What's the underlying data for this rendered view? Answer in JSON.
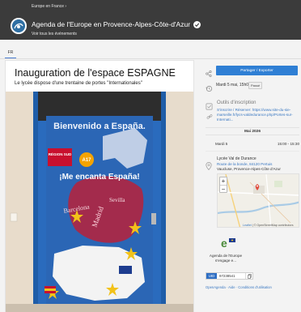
{
  "header": {
    "breadcrumb": "Europe en France ›",
    "title": "Agenda de l'Europe en Provence-Alpes-Côte-d'Azur",
    "all_events_link": "Voir tous les événements"
  },
  "tabs": [
    {
      "label": "FR",
      "active": true
    }
  ],
  "event": {
    "title": "Inauguration de l'espace ESPAGNE",
    "description": "Le lycée dispose d'une trentaine de portes \"Internationales\"",
    "photo": {
      "slogan_top": "Bienvenido a España.",
      "slogan_middle": "¡Me encanta España!",
      "region_logo_text": "RÉGION SUD",
      "motorway_sign": "A17",
      "words": [
        "Barcelona",
        "Madrid",
        "Sevilla"
      ]
    }
  },
  "sidebar": {
    "share_button": "Partager / Exporter",
    "date_label": "Mardi 5 mai, 15h00",
    "date_badge": "Passé",
    "registration": {
      "title": "Outils d'inscription",
      "text": "S'inscrire / Réserver: https://www.site-du-sie-marseille.fr/lycs-valdedurance.php/Portes-sur-Internati..."
    },
    "calendar": {
      "month": "Mai 2026",
      "day": "Mardi 5",
      "time": "15:00 - 15:30"
    },
    "venue": {
      "name": "Lycée Val de Durance",
      "address": "Route de la bonde, 84120 Pertuis",
      "region": "Vaucluse, Provence-Alpes-Côte d'Azur"
    },
    "map": {
      "zoom_in": "+",
      "zoom_out": "−",
      "attribution_link": "Leaflet",
      "attribution_text": " | © OpenStreetMap contributors"
    },
    "agenda": {
      "name": "Agenda de l'Europe s'engage e..."
    },
    "uid": {
      "label": "UID",
      "value": "97238541"
    },
    "footer": "OpenAgenda · Aide · Conditions d'utilisation"
  },
  "colors": {
    "header_bg": "#3b3b3b",
    "accent": "#2f7fd4",
    "link": "#3a78c2"
  }
}
